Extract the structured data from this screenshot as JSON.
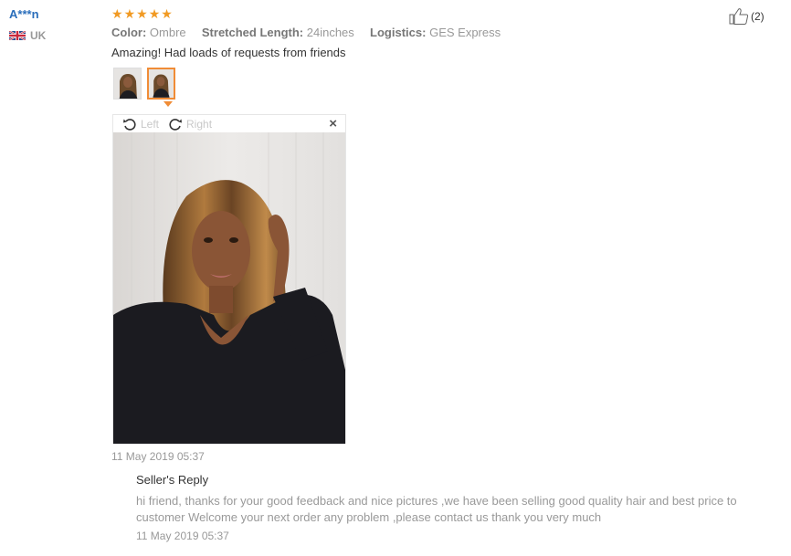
{
  "review": {
    "user_name": "A***n",
    "country": "UK",
    "rating": 5,
    "attributes": [
      {
        "key": "Color:",
        "value": "Ombre"
      },
      {
        "key": "Stretched Length:",
        "value": "24inches"
      },
      {
        "key": "Logistics:",
        "value": "GES Express"
      }
    ],
    "feedback": "Amazing! Had loads of requests from friends",
    "date": "11 May 2019 05:37",
    "helpful_count": "(2)"
  },
  "viewer": {
    "rotate_left": "Left",
    "rotate_right": "Right",
    "close": "×"
  },
  "seller_reply": {
    "title": "Seller's Reply",
    "text": "hi friend, thanks for your good feedback and nice pictures ,we have been selling good quality hair and best price to customer Welcome your next order any problem ,please contact us thank you very much",
    "date": "11 May 2019 05:37"
  },
  "colors": {
    "user_name": "#2a6ebb",
    "star": "#f19a23",
    "active_thumb": "#f08c36"
  },
  "icons": [
    "uk-flag-icon",
    "star-icon",
    "rotate-left-icon",
    "rotate-right-icon",
    "close-icon",
    "thumbs-up-icon"
  ]
}
